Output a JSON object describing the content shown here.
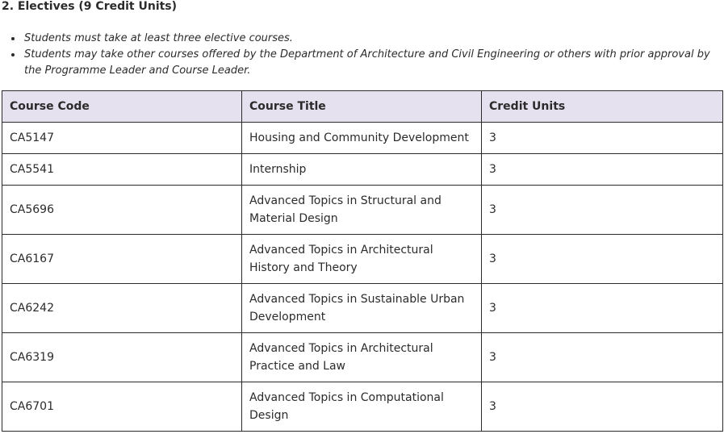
{
  "section": {
    "heading": "2. Electives (9 Credit Units)",
    "notes": [
      "Students must take at least three elective courses.",
      "Students may take other courses offered by the Department of Architecture and Civil Engineering or others with prior approval by the Programme Leader and Course Leader."
    ]
  },
  "table": {
    "headers": [
      "Course Code",
      "Course Title",
      "Credit Units"
    ],
    "rows": [
      {
        "code": "CA5147",
        "title": "Housing and Community Development",
        "credits": "3"
      },
      {
        "code": "CA5541",
        "title": "Internship",
        "credits": "3"
      },
      {
        "code": "CA5696",
        "title": "Advanced Topics in Structural and Material Design",
        "credits": "3"
      },
      {
        "code": "CA6167",
        "title": "Advanced Topics in Architectural History and Theory",
        "credits": "3"
      },
      {
        "code": "CA6242",
        "title": "Advanced Topics in Sustainable Urban Development",
        "credits": "3"
      },
      {
        "code": "CA6319",
        "title": "Advanced Topics in Architectural Practice and Law",
        "credits": "3"
      },
      {
        "code": "CA6701",
        "title": "Advanced Topics in Computational Design",
        "credits": "3"
      }
    ]
  }
}
